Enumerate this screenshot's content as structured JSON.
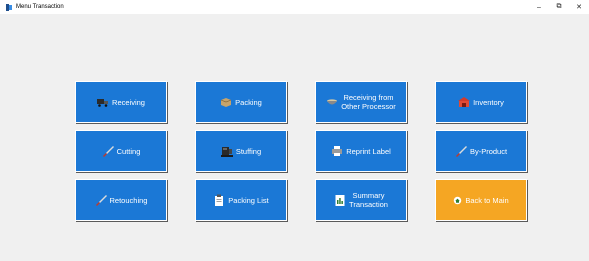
{
  "window": {
    "title": "Menu Transaction",
    "min": "–",
    "max": "⧉",
    "close": "✕"
  },
  "buttons": [
    {
      "label": "Receiving",
      "icon": "truck-icon"
    },
    {
      "label": "Packing",
      "icon": "box-icon"
    },
    {
      "label": "Receiving from\nOther Processor",
      "icon": "bowl-icon"
    },
    {
      "label": "Inventory",
      "icon": "warehouse-icon"
    },
    {
      "label": "Cutting",
      "icon": "knife-icon"
    },
    {
      "label": "Stuffing",
      "icon": "machine-icon"
    },
    {
      "label": "Reprint Label",
      "icon": "printer-icon"
    },
    {
      "label": "By-Product",
      "icon": "knife-icon"
    },
    {
      "label": "Retouching",
      "icon": "knife-icon"
    },
    {
      "label": "Packing List",
      "icon": "clipboard-icon"
    },
    {
      "label": "Summary\nTransaction",
      "icon": "report-icon"
    },
    {
      "label": "Back to Main",
      "icon": "home-icon"
    }
  ],
  "colors": {
    "button_blue": "#1b78d6",
    "back_orange": "#f5a623"
  }
}
